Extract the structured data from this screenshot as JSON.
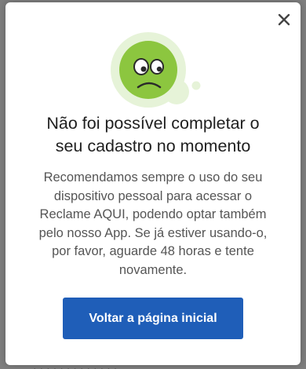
{
  "modal": {
    "close_icon": "close-icon",
    "illustration_icon": "sad-face-icon",
    "title_line1": "Não foi possível completar o",
    "title_line2": "seu cadastro no momento",
    "message_lines": [
      "Recomendamos sempre o uso do seu",
      "dispositivo pessoal para acessar o",
      "Reclame AQUI, podendo optar também",
      "pelo nosso App. Se já estiver usando-o,",
      "por favor, aguarde 48 horas e tente",
      "novamente."
    ],
    "primary_button_label": "Voltar a página inicial"
  },
  "colors": {
    "overlay": "#7f7f7f",
    "modal_background": "#ffffff",
    "primary_button": "#1f5eb8",
    "face_green": "#8cc63f",
    "halo_green": "#e6f3d8"
  }
}
